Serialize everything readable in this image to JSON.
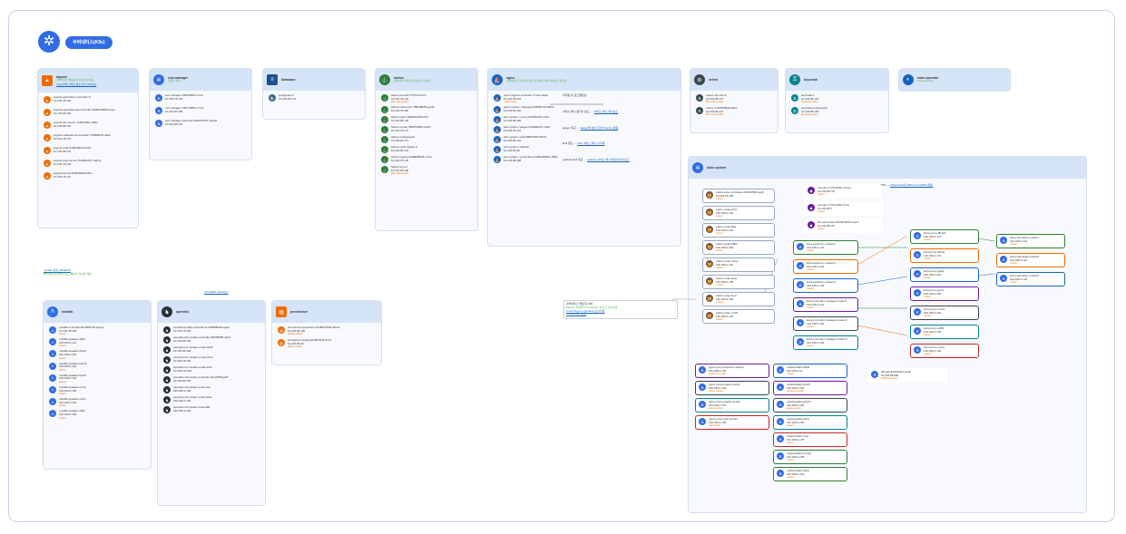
{
  "header": {
    "title": "쿠버네티스(K8s)"
  },
  "argocd": {
    "title": "argocd",
    "sub": "쿠버네티스 배포용 GitOps 대시보드",
    "link": "ArgoCD와 깃허브 배포 관리 (GitOps)",
    "items": [
      {
        "name": "argocd-application-controller-0",
        "ip": "10.233.78.164"
      },
      {
        "name": "argocd-applicationset-controller-7b85b9468b-2zgct",
        "ip": "10.233.96.184"
      },
      {
        "name": "argocd-dex-server-7c48bc54fc-clf8w",
        "ip": "10.233.98.151"
      },
      {
        "name": "argocd-notifications-controller-75588fdc8-x4kt9",
        "ip": "10.233.78.178"
      },
      {
        "name": "argocd-redis-5cf8f4b9bd-wz6th",
        "ip": "10.233.98.175"
      },
      {
        "name": "argocd-repo-server-76c88ccb57-nwhz2",
        "ip": "10.233.78.163"
      },
      {
        "name": "argocd-server-5f49f9b4f8-kh5zc",
        "ip": "10.233.78.141"
      }
    ]
  },
  "certmanager": {
    "title": "cert-manager",
    "sub": "인증서 관리",
    "items": [
      {
        "name": "cert-manager-789c5b85cc-f7x2",
        "ip": "10.233.78.134"
      },
      {
        "name": "cert-manager-788c7b85cc-77x2",
        "ip": "10.233.96.180"
      },
      {
        "name": "cert-manager-webhook-5487fb47bb-n9pb6",
        "ip": "10.233.98.153"
      }
    ]
  },
  "database": {
    "title": "Database",
    "items": [
      {
        "name": "postgresql-0",
        "ip": "10.233.98.174"
      }
    ]
  },
  "harbor": {
    "title": "harbor",
    "sub": "컨테이너 이미지 레지스트리 저장소",
    "items": [
      {
        "name": "harbor-core-5c775754-2zr7m",
        "ip": "10.233.78.134",
        "role": "k8s-node-worker"
      },
      {
        "name": "harbor-jobservice-7884d8b59-gxs8v",
        "ip": "10.233.78.155"
      },
      {
        "name": "harbor-nginx-6d8e55b495-6fdz",
        "ip": "10.233.96.146"
      },
      {
        "name": "harbor-portal-7896876845-hvsb9",
        "ip": "10.233.78.171"
      },
      {
        "name": "harbor-postgresql-0",
        "ip": "10.233.96.171"
      },
      {
        "name": "harbor-redis-master-0",
        "ip": "10.233.96.143"
      },
      {
        "name": "harbor-registry-5b888f5945-zmv6",
        "ip": "10.233.78.145"
      },
      {
        "name": "harbor-trivy-0",
        "ip": "10.233.98.146",
        "role": "k8s-node-worker"
      }
    ]
  },
  "nginx": {
    "title": "nginx",
    "sub": "쿠버네티스 클러스터 외부 트래픽을 내부 서비스로 라우팅",
    "items": [
      {
        "name": "nginx-ingress-controller-7c7cd-4wsrk",
        "ip": "10.233.78.134",
        "role": "node-worker"
      },
      {
        "name": "nginx-system / gateway-5c68f6c44-699bb",
        "ip": "10.233.96.181"
      },
      {
        "name": "istio-system / envoy-6bf7f8d75c-r7k6x",
        "ip": "10.233.98.184"
      },
      {
        "name": "istio-system / jaeger-fc4d68d547-xh4fx",
        "ip": "10.233.78.131"
      },
      {
        "name": "istio-system / kiali-dff5b646f4-5t6n5",
        "ip": "10.233.96.101"
      },
      {
        "name": "istio-system / kiali-k8",
        "ip": "10.233.96.98"
      },
      {
        "name": "istio-system / prometheus-5b5d4f8684-n5fk2",
        "ip": "10.233.98.158"
      }
    ],
    "notes": [
      {
        "label": "라우팅 및 로드밸런싱",
        "link": ""
      },
      {
        "label": "서비스 메시 웹 대시보드",
        "link": "서비스 메시 대시보드"
      },
      {
        "label": "jaeger 접근",
        "link": "Jaeger와 분산 추적 Tracing 활용"
      },
      {
        "label": "kiali 접근",
        "link": "Kiali 서비스 메시 시각화"
      },
      {
        "label": "grafana kiali 접근",
        "link": "grafana 서비스 메시 메트릭 대시보드"
      }
    ]
  },
  "velero": {
    "title": "velero",
    "items": [
      {
        "name": "velero-nfs-cdsr-8",
        "ip": "10.233.98.173",
        "role": "k8s-node-worker"
      },
      {
        "name": "velero-ui-9f4f7f8849-t6kpx",
        "ip": "10.233.96.172",
        "role": "k8s-node-worker"
      }
    ]
  },
  "keycloak": {
    "title": "keycloak",
    "items": [
      {
        "name": "keycloak-0",
        "ip": "10.233.96.176",
        "role": "keycloak-worker"
      },
      {
        "name": "keycloak-postgresql-0",
        "ip": "10.233.98.165",
        "role": "keycloak-worker"
      }
    ]
  },
  "kubeoperator": {
    "title": "kube-operator",
    "sub": "kube-operator"
  },
  "metallb": {
    "title": "metallb",
    "notes": [
      "metallb 설정 (MetalLB)",
      "베어메탈 환경에서 로드밸런서 기능을 제공"
    ],
    "items": [
      {
        "name": "metallb-controller-5bc95f9745-wqsmj",
        "ip": "10.233.78.129",
        "role": "worker"
      },
      {
        "name": "metallb-speaker-2jff4l",
        "ip": "192.168.2.121",
        "role": "master"
      },
      {
        "name": "metallb-speaker-5fgxd",
        "ip": "192.168.2.104",
        "role": "worker"
      },
      {
        "name": "metallb-speaker-hwrv9",
        "ip": "192.168.2.102",
        "role": "worker"
      },
      {
        "name": "metallb-speaker-hpc9t",
        "ip": "192.168.2.103",
        "role": "master"
      },
      {
        "name": "metallb-speaker-mzzg",
        "ip": "192.168.2.105",
        "role": "worker"
      },
      {
        "name": "metallb-speaker-qmrlv",
        "ip": "192.168.2.101",
        "role": "master"
      },
      {
        "name": "metallb-speaker-xj8lg",
        "ip": "192.168.2.106",
        "role": "worker"
      }
    ]
  },
  "openebs": {
    "title": "openebs",
    "note": "OpenEBS (Storage)",
    "items": [
      {
        "name": "openebs-localpv-provisioner-5d9985b9b-wqjxv",
        "ip": "10.233.78.162"
      },
      {
        "name": "openebs-lvm-localpv-controller-664f5f668-clpwt",
        "ip": "10.233.98.160"
      },
      {
        "name": "openebs-lvm-localpv-node-5xj68",
        "ip": "10.233.96.183"
      },
      {
        "name": "openebs-lvm-localpv-node-2zmk",
        "ip": "10.233.78.160"
      },
      {
        "name": "openebs-lvm-localpv-node-w2rlt",
        "ip": "10.233.124.181"
      },
      {
        "name": "openebs-zfs-localpv-controller-dbcd7f98-gs87",
        "ip": "10.233.96.155"
      },
      {
        "name": "openebs-zfs-localpv-node-wxjf",
        "ip": "192.168.2.106"
      },
      {
        "name": "openebs-zfs-localpv-node-ph4d",
        "ip": "192.168.2.105"
      },
      {
        "name": "openebs-zfs-localpv-node-k8d",
        "ip": "192.168.2.100"
      }
    ]
  },
  "provisioner": {
    "title": "provisioner",
    "items": [
      {
        "name": "provisioner-operationk-7f4d6f67f646-5lmdb",
        "ip": "10.233.96.190",
        "role": "deploy-worker"
      },
      {
        "name": "provisioner-deploy-6b45f76cbf-8mzz",
        "ip": "10.233.96.26",
        "role": "deploy-worker"
      }
    ]
  },
  "kubesystem": {
    "title": "kube-system",
    "coredns": [
      {
        "name": "calico-kube-controllers-6b8c5f899-qxg5",
        "ip": "10.233.78.186",
        "role": "worker"
      },
      {
        "name": "calico-node-2p7rx",
        "ip": "192.168.2.103",
        "role": "worker"
      },
      {
        "name": "calico-node-8tjwl",
        "ip": "192.168.2.101",
        "role": "worker"
      },
      {
        "name": "calico-node-hf8k2",
        "ip": "192.168.2.102",
        "role": "worker"
      },
      {
        "name": "calico-node-mvrks",
        "ip": "192.168.2.104",
        "role": "worker"
      },
      {
        "name": "calico-node-kswm",
        "ip": "192.168.2.105",
        "role": "master"
      },
      {
        "name": "calico-node-lhyvz",
        "ip": "192.168.2.106",
        "role": "master"
      },
      {
        "name": "calico-node-vmrt8",
        "ip": "192.168.2.120",
        "role": "master"
      }
    ],
    "top": [
      {
        "name": "coredns-7775c4f48c-6rmsq",
        "ip": "10.233.98.141",
        "role": "worker"
      },
      {
        "name": "coredns-7775c4f48c-5n7g",
        "ip": "10.233.96.9",
        "role": "worker"
      },
      {
        "name": "dns-autoscaler-8579bdd59c-hcjv4",
        "ip": "10.233.98.167",
        "role": "worker"
      }
    ],
    "topnote": {
      "label": "DNS",
      "link": "Kubernetes의 DNS (CoreDNS 설정)"
    },
    "apiservers": [
      {
        "name": "kube-apiserver-master1",
        "ip": "192.168.2.121",
        "role": "master"
      },
      {
        "name": "kube-apiserver-master2",
        "ip": "192.168.2.122",
        "role": "master"
      },
      {
        "name": "kube-apiserver-master3",
        "ip": "192.168.2.123",
        "role": "master"
      },
      {
        "name": "kube-controller-manager-master1",
        "ip": "192.168.2.121",
        "role": "master"
      },
      {
        "name": "kube-controller-manager-master2",
        "ip": "192.168.2.122",
        "role": "master"
      },
      {
        "name": "kube-controller-manager-master3",
        "ip": "192.168.2.123",
        "role": "master"
      }
    ],
    "proxies": [
      {
        "name": "kube-proxy-8bd2m",
        "ip": "192.168.2.121",
        "role": "master"
      },
      {
        "name": "kube-proxy-6thdq",
        "ip": "192.168.2.101",
        "role": "master"
      },
      {
        "name": "kube-proxy-gt2pl",
        "ip": "192.168.2.122",
        "role": "master"
      },
      {
        "name": "kube-proxy-jpvrs",
        "ip": "192.168.2.103",
        "role": "worker"
      },
      {
        "name": "kube-proxy-vrs21",
        "ip": "192.168.2.123",
        "role": "master"
      },
      {
        "name": "kube-proxy-wf56",
        "ip": "192.168.2.105",
        "role": "worker"
      },
      {
        "name": "kube-proxy-vxsnj",
        "ip": "192.168.2.102",
        "role": "worker"
      }
    ],
    "schedulers": [
      {
        "name": "kube-scheduler-master1",
        "ip": "192.168.2.121",
        "role": "master"
      },
      {
        "name": "kube-scheduler-master2",
        "ip": "192.168.2.122",
        "role": "master"
      },
      {
        "name": "kube-scheduler-master3",
        "ip": "192.168.2.123",
        "role": "master"
      }
    ],
    "nginxproxy": [
      {
        "name": "nginx-proxy-hacheme-worker",
        "ip": "192.168.2.100",
        "role": "hacheme-worker"
      },
      {
        "name": "nginx-proxy-riesgo-worker",
        "ip": "192.168.2.103",
        "role": "riesgo-worker"
      },
      {
        "name": "nginx-proxy-elastic-worker",
        "ip": "192.168.2.104",
        "role": "elastic-worker"
      },
      {
        "name": "nginx-proxy-web-worker",
        "ip": "192.168.2.105",
        "role": "web-worker"
      }
    ],
    "nodelocal": [
      {
        "name": "nodelocaldns-96fj6",
        "ip": "192.168.2.12",
        "role": "master"
      },
      {
        "name": "nodelocaldns-9stz5",
        "ip": "192.168.2.120",
        "role": "hacheme-worker"
      },
      {
        "name": "nodelocaldns-ghg77",
        "ip": "192.168.2.125",
        "role": "elastic-worker"
      },
      {
        "name": "nodelocaldns-dfbd",
        "ip": "192.168.2.165",
        "role": "worker"
      },
      {
        "name": "nodelocaldns-bvkr",
        "ip": "192.168.2.178",
        "role": "worker"
      },
      {
        "name": "nodelocaldns-mhvgf",
        "ip": "192.168.2.168",
        "role": "master"
      },
      {
        "name": "nodelocaldns-fk9ts",
        "ip": "192.168.2.124",
        "role": "worker"
      }
    ],
    "metrics": {
      "name": "k8s-api-9b6d979bf-sjo29",
      "ip": "10.233.98.806",
      "role": "ZXShow-worker"
    }
  },
  "bottomnote": {
    "line1": "쿠버네티스 메트릭 서버",
    "line2": "Metrics 서버와 Prometheus 리소스 모니터링",
    "link1": "Prometheus & Grafana 모니터링",
    "link2": "Product 대시보드"
  },
  "colors": {
    "accent": "#326ce5",
    "panel_head": "#d6e4f7",
    "role": "#ef6c00",
    "sub": "#4caf50"
  }
}
